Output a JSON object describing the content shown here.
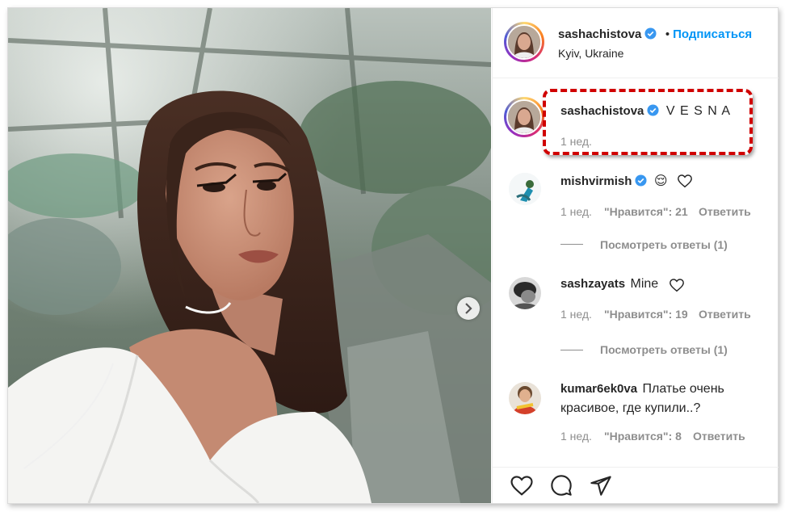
{
  "post": {
    "author": "sashachistova",
    "follow_label": "Подписаться",
    "location": "Kyiv, Ukraine",
    "caption_user": "sashachistova",
    "caption_text": "V E S N A",
    "caption_time": "1 нед."
  },
  "comments": [
    {
      "user": "mishvirmish",
      "text": "",
      "emoji": "😌",
      "time": "1 нед.",
      "likes": "\"Нравится\": 21",
      "reply": "Ответить",
      "view_replies": "Посмотреть ответы (1)"
    },
    {
      "user": "sashzayats",
      "text": "Mine",
      "time": "1 нед.",
      "likes": "\"Нравится\": 19",
      "reply": "Ответить",
      "view_replies": "Посмотреть ответы (1)"
    },
    {
      "user": "kumar6ek0va",
      "text": "Платье очень",
      "text_line2": "красивое, где купили..?",
      "time": "1 нед.",
      "likes": "\"Нравится\": 8",
      "reply": "Ответить"
    }
  ],
  "icons": {
    "verified": "verified-badge-icon",
    "like": "heart-icon",
    "comment": "comment-bubble-icon",
    "share": "paper-plane-icon",
    "next": "chevron-right-icon"
  },
  "colors": {
    "accent": "#0095f6",
    "verified": "#3897f0",
    "highlight": "#d00000",
    "muted": "#8e8e8e"
  }
}
